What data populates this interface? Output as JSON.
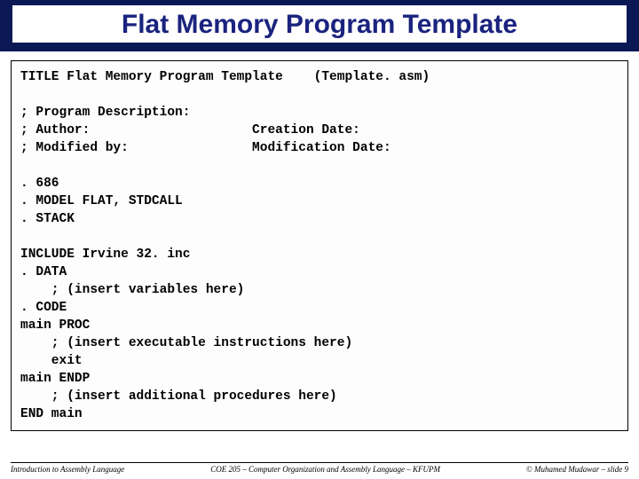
{
  "title": "Flat Memory Program Template",
  "code": "TITLE Flat Memory Program Template    (Template. asm)\n\n; Program Description:\n; Author:                     Creation Date:\n; Modified by:                Modification Date:\n\n. 686\n. MODEL FLAT, STDCALL\n. STACK\n\nINCLUDE Irvine 32. inc\n. DATA\n    ; (insert variables here)\n. CODE\nmain PROC\n    ; (insert executable instructions here)\n    exit\nmain ENDP\n    ; (insert additional procedures here)\nEND main",
  "footer": {
    "left": "Introduction to Assembly Language",
    "center": "COE 205 – Computer Organization and Assembly Language – KFUPM",
    "right": "© Muhamed Mudawar – slide 9"
  }
}
